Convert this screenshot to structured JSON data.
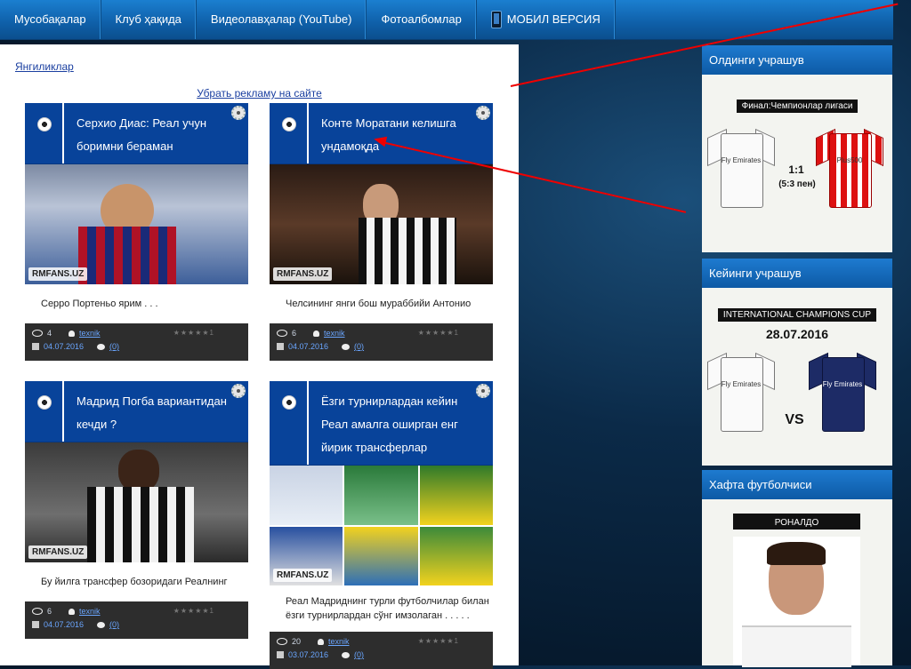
{
  "nav": {
    "items": [
      "Мусобақалар",
      "Клуб ҳақида",
      "Видеолавҳалар (YouTube)",
      "Фотоалбомлар"
    ],
    "mobile": "МОБИЛ ВЕРСИЯ"
  },
  "breadcrumb": "Янгиликлар",
  "ad_link": "Убрать рекламу на сайте",
  "cards": [
    {
      "title": "Серхио Диас: Реал учун боримни бераман",
      "excerpt": "Серро Портеньо ярим . . .",
      "views": "4",
      "author": "texnik",
      "date": "04.07.2016",
      "comments": "(0)",
      "watermark": "RMFANS.UZ"
    },
    {
      "title": "Конте Моратани келишга ундамоқда",
      "excerpt": "Челсининг янги бош мураббийи Антонио",
      "views": "6",
      "author": "texnik",
      "date": "04.07.2016",
      "comments": "(0)",
      "watermark": "RMFANS.UZ"
    },
    {
      "title": "Мадрид Погба вариантидан кечди ?",
      "excerpt": "Бу йилга трансфер бозоридаги Реалнинг",
      "views": "6",
      "author": "texnik",
      "date": "04.07.2016",
      "comments": "(0)",
      "watermark": "RMFANS.UZ"
    },
    {
      "title": "Ёзги турнирлардан кейин Реал амалга оширган енг йирик трансферлар",
      "excerpt": "Реал Мадриднинг турли футболчилар билан ёзги турнирлардан сўнг имзолаган . . . . .",
      "views": "20",
      "author": "texnik",
      "date": "03.07.2016",
      "comments": "(0)",
      "watermark": "RMFANS.UZ"
    }
  ],
  "stars": "★★★★★1",
  "sidebar": {
    "prev": {
      "heading": "Олдинги учрашув",
      "banner": "Финал:Чемпионлар лигаси",
      "score": "1:1",
      "pens": "(5:3 пен)",
      "brand_left": "Fly Emirates",
      "brand_right": "Plus500"
    },
    "next": {
      "heading": "Кейинги учрашув",
      "banner": "INTERNATIONAL CHAMPIONS CUP",
      "date": "28.07.2016",
      "vs": "VS",
      "brand_left": "Fly Emirates",
      "brand_right": "Fly Emirates"
    },
    "player": {
      "heading": "Хафта футболчиси",
      "banner": "РОНАЛДО"
    }
  },
  "colors": {
    "nav": "#1b7fd0",
    "card_head": "#08439a",
    "arrow": "#e00000"
  }
}
